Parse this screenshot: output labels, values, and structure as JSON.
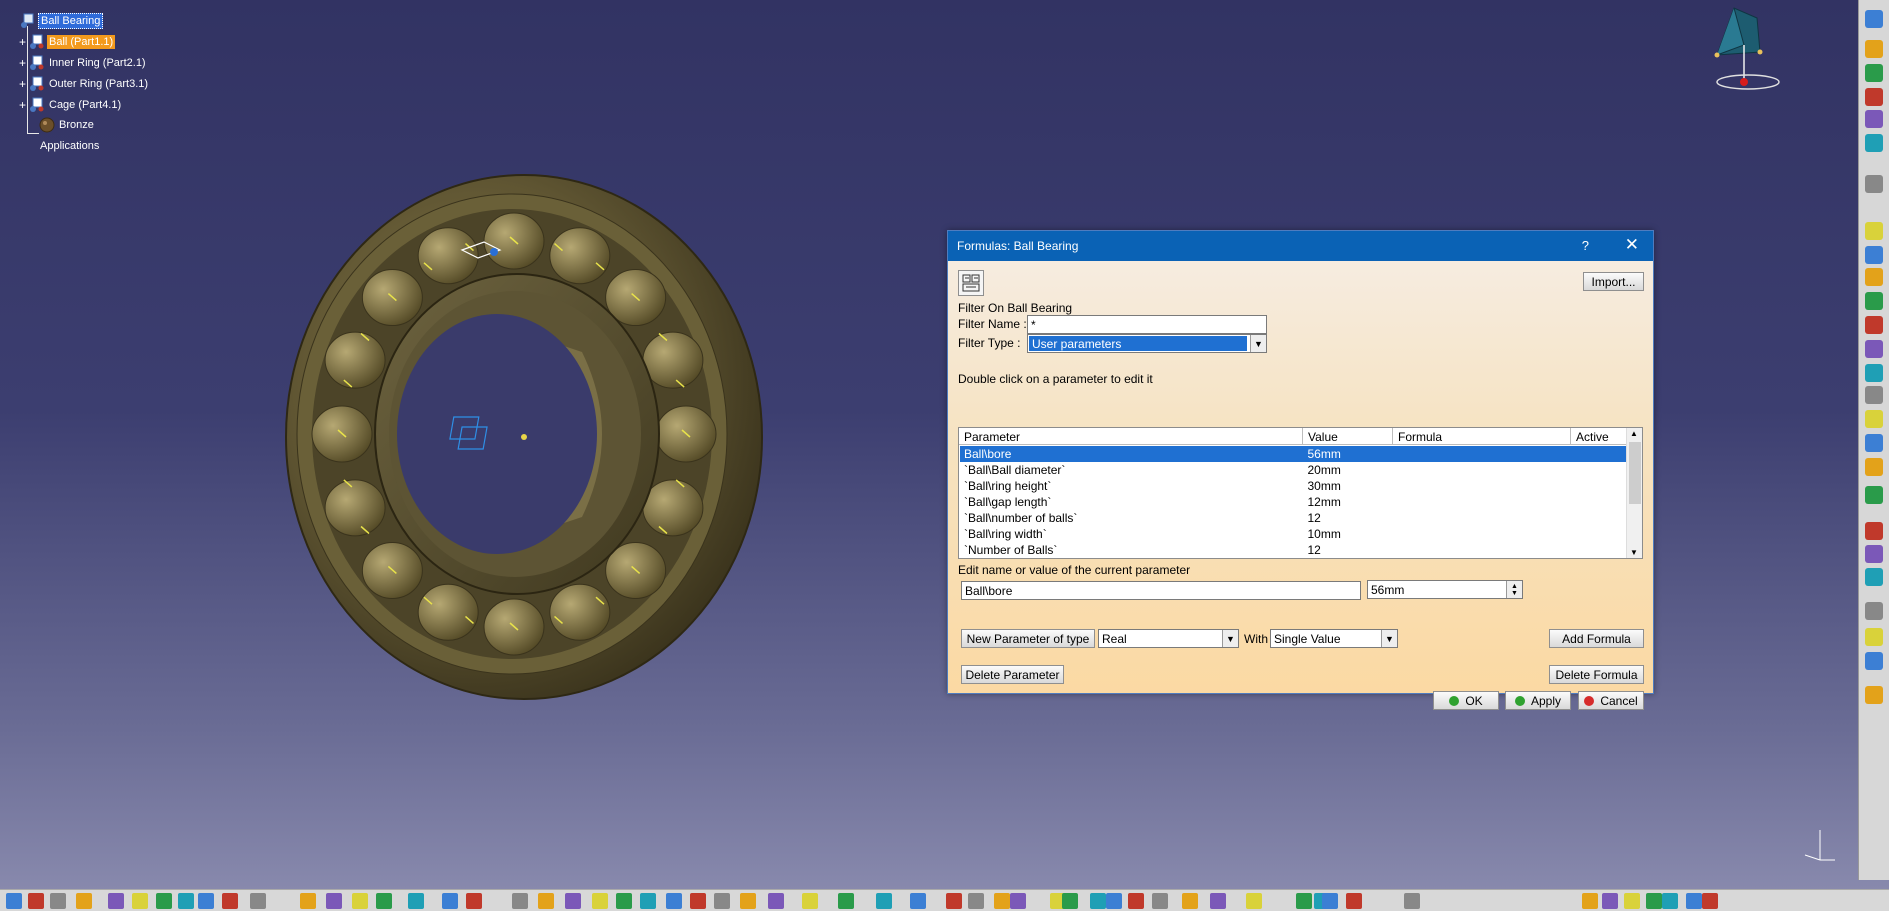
{
  "tree": {
    "root": "Ball Bearing",
    "children": [
      {
        "label": "Ball (Part1.1)"
      },
      {
        "label": "Inner Ring (Part2.1)"
      },
      {
        "label": "Outer Ring (Part3.1)"
      },
      {
        "label": "Cage (Part4.1)"
      }
    ],
    "material": "Bronze",
    "applications": "Applications"
  },
  "dialog": {
    "title": "Formulas: Ball Bearing",
    "help": "?",
    "close": "✕",
    "import_label": "Import...",
    "filter_on": "Filter On Ball Bearing",
    "filter_name_label": "Filter Name :",
    "filter_name_value": "*",
    "filter_type_label": "Filter Type :",
    "filter_type_value": "User parameters",
    "double_click_hint": "Double click on a parameter to edit it",
    "columns": [
      "Parameter",
      "Value",
      "Formula",
      "Active"
    ],
    "rows": [
      {
        "parameter": "Ball\\bore",
        "value": "56mm",
        "formula": "",
        "active": ""
      },
      {
        "parameter": "`Ball\\Ball diameter`",
        "value": "20mm",
        "formula": "",
        "active": ""
      },
      {
        "parameter": "`Ball\\ring height`",
        "value": "30mm",
        "formula": "",
        "active": ""
      },
      {
        "parameter": "`Ball\\gap length`",
        "value": "12mm",
        "formula": "",
        "active": ""
      },
      {
        "parameter": "`Ball\\number of balls`",
        "value": "12",
        "formula": "",
        "active": ""
      },
      {
        "parameter": "`Ball\\ring width`",
        "value": "10mm",
        "formula": "",
        "active": ""
      },
      {
        "parameter": "`Number of Balls`",
        "value": "12",
        "formula": "",
        "active": ""
      }
    ],
    "edit_label": "Edit name or value of the current parameter",
    "edit_name": "Ball\\bore",
    "edit_value": "56mm",
    "new_param_label": "New Parameter of type",
    "type_value": "Real",
    "with_label": "With",
    "with_value": "Single Value",
    "add_formula": "Add Formula",
    "delete_parameter": "Delete Parameter",
    "delete_formula": "Delete Formula",
    "ok": "OK",
    "apply": "Apply",
    "cancel": "Cancel"
  },
  "colors": {
    "title_bar": "#0a62b5",
    "selection": "#1f70d2",
    "tree_highlight": "#f39a1d",
    "viewport_bg": "#323363"
  }
}
